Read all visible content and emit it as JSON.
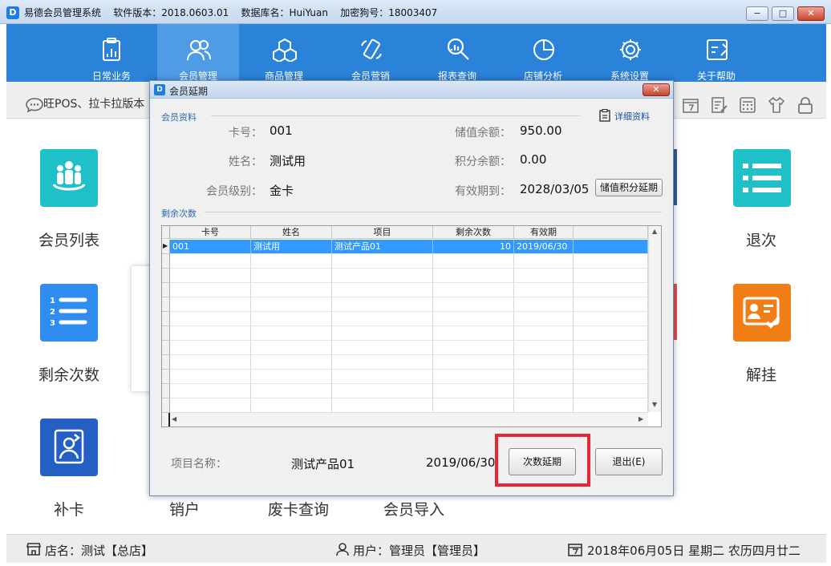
{
  "window": {
    "title": "易德会员管理系统    软件版本：2018.0603.01    数据库名：HuiYuan    加密狗号：18003407",
    "minimize": "−",
    "restore": "□",
    "close": "✕"
  },
  "nav": {
    "items": [
      {
        "label": "日常业务",
        "icon": "clipboard-icon"
      },
      {
        "label": "会员管理",
        "icon": "members-icon"
      },
      {
        "label": "商品管理",
        "icon": "cubes-icon"
      },
      {
        "label": "会员营销",
        "icon": "phone-icon"
      },
      {
        "label": "报表查询",
        "icon": "search-chart-icon"
      },
      {
        "label": "店铺分析",
        "icon": "pie-icon"
      },
      {
        "label": "系统设置",
        "icon": "gear-icon"
      },
      {
        "label": "关于帮助",
        "icon": "help-icon"
      }
    ],
    "active_index": 1
  },
  "marquee": {
    "text": "旺POS、拉卡拉版本"
  },
  "tiles": {
    "member_list": "会员列表",
    "remaining_times": "剩余次数",
    "reissue_card": "补卡",
    "cancel_card": "销户",
    "void_card_query": "废卡查询",
    "member_import": "会员导入",
    "refund_times": "退次",
    "unfreeze": "解挂"
  },
  "status": {
    "store": "店名：测试【总店】",
    "user": "用户：管理员【管理员】",
    "date": "2018年06月05日 星期二 农历四月廿二"
  },
  "dialog": {
    "title": "会员延期",
    "section_member": "会员资料",
    "detail_link": "详细资料",
    "fields": {
      "card_label": "卡号：",
      "card": "001",
      "name_label": "姓名：",
      "name": "测试用",
      "level_label": "会员级别：",
      "level": "金卡",
      "balance_label": "储值余额：",
      "balance": "950.00",
      "points_label": "积分余额：",
      "points": "0.00",
      "expiry_label": "有效期到：",
      "expiry": "2028/03/05"
    },
    "extend_points_button": "储值积分延期",
    "section_times": "剩余次数",
    "grid": {
      "headers": [
        "卡号",
        "姓名",
        "项目",
        "剩余次数",
        "有效期"
      ],
      "rows": [
        [
          "001",
          "测试用",
          "测试产品01",
          "10",
          "2019/06/30"
        ]
      ]
    },
    "item_label": "项目名称：",
    "item_value": "测试产品01",
    "item_date": "2019/06/30",
    "extend_times_button": "次数延期",
    "exit_button": "退出(E)"
  }
}
